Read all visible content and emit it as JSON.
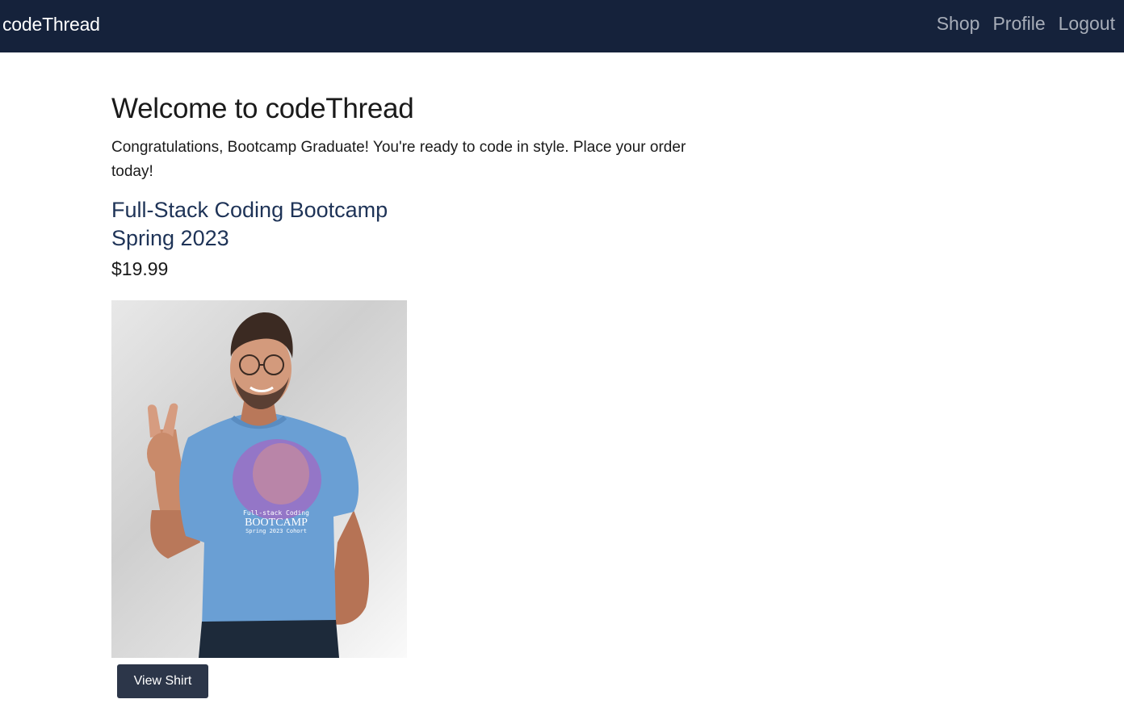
{
  "navbar": {
    "brand": "codeThread",
    "links": [
      "Shop",
      "Profile",
      "Logout"
    ]
  },
  "main": {
    "heading": "Welcome to codeThread",
    "intro": "Congratulations, Bootcamp Graduate! You're ready to code in style. Place your order today!",
    "product": {
      "name_line1": "Full-Stack Coding Bootcamp",
      "name_line2": "Spring 2023",
      "price": "$19.99",
      "shirt_print": {
        "line1": "Full-stack Coding",
        "line2": "BOOTCAMP",
        "line3": "Spring 2023 Cohort"
      },
      "button_label": "View Shirt"
    }
  },
  "colors": {
    "navbar_bg": "#15223b",
    "product_title": "#1e3357",
    "button_bg": "#2c3649",
    "shirt": "#6a9fd4"
  }
}
